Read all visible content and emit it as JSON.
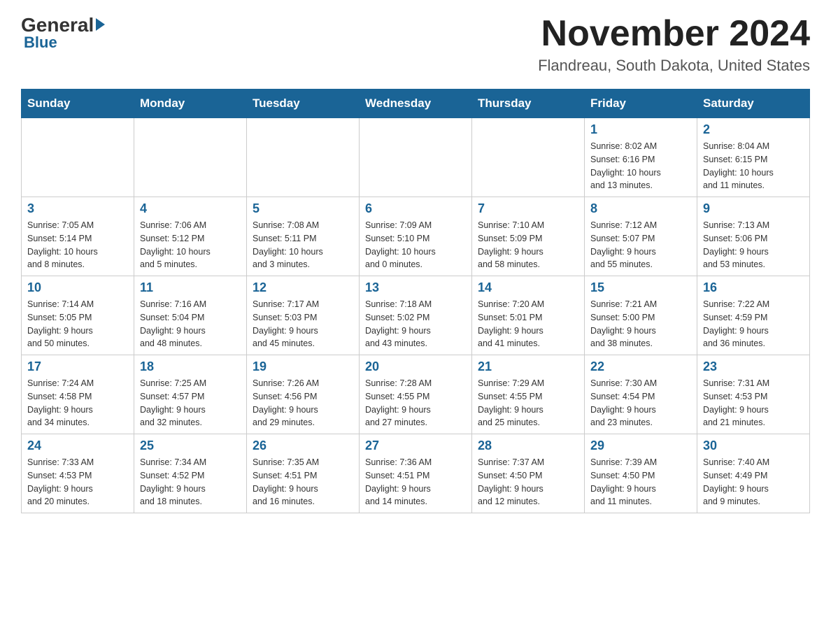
{
  "logo": {
    "general": "General",
    "blue": "Blue",
    "arrow": "▶"
  },
  "header": {
    "month_year": "November 2024",
    "location": "Flandreau, South Dakota, United States"
  },
  "days_of_week": [
    "Sunday",
    "Monday",
    "Tuesday",
    "Wednesday",
    "Thursday",
    "Friday",
    "Saturday"
  ],
  "weeks": [
    [
      {
        "day": "",
        "info": ""
      },
      {
        "day": "",
        "info": ""
      },
      {
        "day": "",
        "info": ""
      },
      {
        "day": "",
        "info": ""
      },
      {
        "day": "",
        "info": ""
      },
      {
        "day": "1",
        "info": "Sunrise: 8:02 AM\nSunset: 6:16 PM\nDaylight: 10 hours\nand 13 minutes."
      },
      {
        "day": "2",
        "info": "Sunrise: 8:04 AM\nSunset: 6:15 PM\nDaylight: 10 hours\nand 11 minutes."
      }
    ],
    [
      {
        "day": "3",
        "info": "Sunrise: 7:05 AM\nSunset: 5:14 PM\nDaylight: 10 hours\nand 8 minutes."
      },
      {
        "day": "4",
        "info": "Sunrise: 7:06 AM\nSunset: 5:12 PM\nDaylight: 10 hours\nand 5 minutes."
      },
      {
        "day": "5",
        "info": "Sunrise: 7:08 AM\nSunset: 5:11 PM\nDaylight: 10 hours\nand 3 minutes."
      },
      {
        "day": "6",
        "info": "Sunrise: 7:09 AM\nSunset: 5:10 PM\nDaylight: 10 hours\nand 0 minutes."
      },
      {
        "day": "7",
        "info": "Sunrise: 7:10 AM\nSunset: 5:09 PM\nDaylight: 9 hours\nand 58 minutes."
      },
      {
        "day": "8",
        "info": "Sunrise: 7:12 AM\nSunset: 5:07 PM\nDaylight: 9 hours\nand 55 minutes."
      },
      {
        "day": "9",
        "info": "Sunrise: 7:13 AM\nSunset: 5:06 PM\nDaylight: 9 hours\nand 53 minutes."
      }
    ],
    [
      {
        "day": "10",
        "info": "Sunrise: 7:14 AM\nSunset: 5:05 PM\nDaylight: 9 hours\nand 50 minutes."
      },
      {
        "day": "11",
        "info": "Sunrise: 7:16 AM\nSunset: 5:04 PM\nDaylight: 9 hours\nand 48 minutes."
      },
      {
        "day": "12",
        "info": "Sunrise: 7:17 AM\nSunset: 5:03 PM\nDaylight: 9 hours\nand 45 minutes."
      },
      {
        "day": "13",
        "info": "Sunrise: 7:18 AM\nSunset: 5:02 PM\nDaylight: 9 hours\nand 43 minutes."
      },
      {
        "day": "14",
        "info": "Sunrise: 7:20 AM\nSunset: 5:01 PM\nDaylight: 9 hours\nand 41 minutes."
      },
      {
        "day": "15",
        "info": "Sunrise: 7:21 AM\nSunset: 5:00 PM\nDaylight: 9 hours\nand 38 minutes."
      },
      {
        "day": "16",
        "info": "Sunrise: 7:22 AM\nSunset: 4:59 PM\nDaylight: 9 hours\nand 36 minutes."
      }
    ],
    [
      {
        "day": "17",
        "info": "Sunrise: 7:24 AM\nSunset: 4:58 PM\nDaylight: 9 hours\nand 34 minutes."
      },
      {
        "day": "18",
        "info": "Sunrise: 7:25 AM\nSunset: 4:57 PM\nDaylight: 9 hours\nand 32 minutes."
      },
      {
        "day": "19",
        "info": "Sunrise: 7:26 AM\nSunset: 4:56 PM\nDaylight: 9 hours\nand 29 minutes."
      },
      {
        "day": "20",
        "info": "Sunrise: 7:28 AM\nSunset: 4:55 PM\nDaylight: 9 hours\nand 27 minutes."
      },
      {
        "day": "21",
        "info": "Sunrise: 7:29 AM\nSunset: 4:55 PM\nDaylight: 9 hours\nand 25 minutes."
      },
      {
        "day": "22",
        "info": "Sunrise: 7:30 AM\nSunset: 4:54 PM\nDaylight: 9 hours\nand 23 minutes."
      },
      {
        "day": "23",
        "info": "Sunrise: 7:31 AM\nSunset: 4:53 PM\nDaylight: 9 hours\nand 21 minutes."
      }
    ],
    [
      {
        "day": "24",
        "info": "Sunrise: 7:33 AM\nSunset: 4:53 PM\nDaylight: 9 hours\nand 20 minutes."
      },
      {
        "day": "25",
        "info": "Sunrise: 7:34 AM\nSunset: 4:52 PM\nDaylight: 9 hours\nand 18 minutes."
      },
      {
        "day": "26",
        "info": "Sunrise: 7:35 AM\nSunset: 4:51 PM\nDaylight: 9 hours\nand 16 minutes."
      },
      {
        "day": "27",
        "info": "Sunrise: 7:36 AM\nSunset: 4:51 PM\nDaylight: 9 hours\nand 14 minutes."
      },
      {
        "day": "28",
        "info": "Sunrise: 7:37 AM\nSunset: 4:50 PM\nDaylight: 9 hours\nand 12 minutes."
      },
      {
        "day": "29",
        "info": "Sunrise: 7:39 AM\nSunset: 4:50 PM\nDaylight: 9 hours\nand 11 minutes."
      },
      {
        "day": "30",
        "info": "Sunrise: 7:40 AM\nSunset: 4:49 PM\nDaylight: 9 hours\nand 9 minutes."
      }
    ]
  ]
}
